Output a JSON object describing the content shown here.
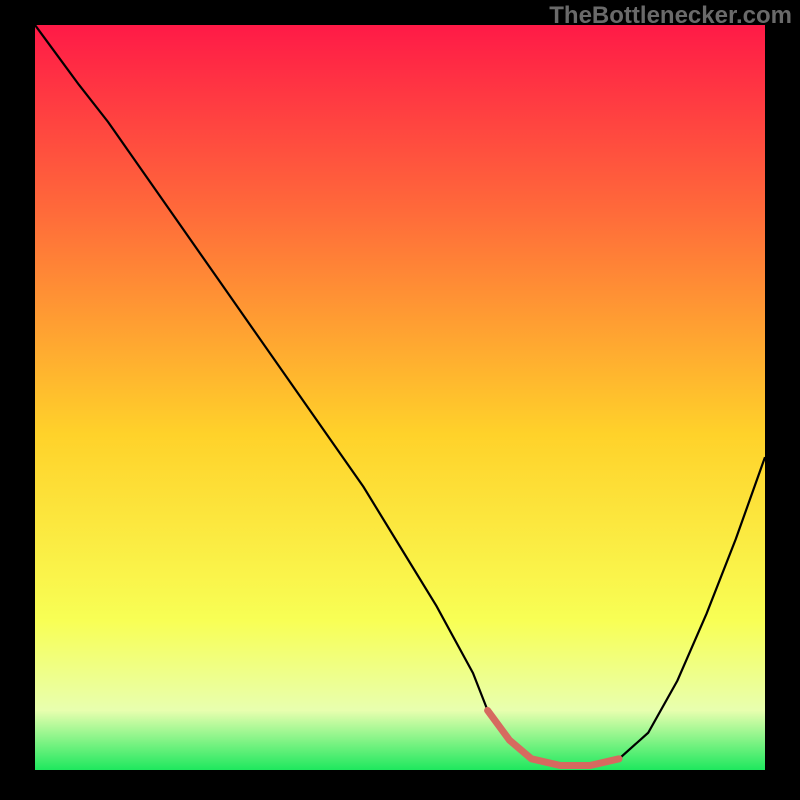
{
  "watermark": "TheBottlenecker.com",
  "chart_data": {
    "type": "line",
    "title": "",
    "xlabel": "",
    "ylabel": "",
    "xlim": [
      0,
      100
    ],
    "ylim": [
      0,
      100
    ],
    "grid": false,
    "background_gradient": {
      "stops": [
        {
          "offset": 0,
          "color": "#ff1a47"
        },
        {
          "offset": 25,
          "color": "#ff6a3a"
        },
        {
          "offset": 55,
          "color": "#ffd22a"
        },
        {
          "offset": 80,
          "color": "#f8ff55"
        },
        {
          "offset": 92,
          "color": "#e8ffaf"
        },
        {
          "offset": 100,
          "color": "#1ee85e"
        }
      ]
    },
    "series": [
      {
        "name": "curve",
        "color": "#000000",
        "x": [
          0,
          3,
          6,
          10,
          15,
          20,
          25,
          30,
          35,
          40,
          45,
          50,
          55,
          60,
          62,
          65,
          68,
          72,
          76,
          80,
          84,
          88,
          92,
          96,
          100
        ],
        "y": [
          100,
          96,
          92,
          87,
          80,
          73,
          66,
          59,
          52,
          45,
          38,
          30,
          22,
          13,
          8,
          4,
          1.5,
          0.6,
          0.6,
          1.5,
          5,
          12,
          21,
          31,
          42
        ]
      }
    ],
    "highlight": {
      "name": "optimal-range",
      "color": "#d66a5f",
      "stroke_width": 7,
      "x": [
        62,
        65,
        68,
        72,
        76,
        80
      ],
      "y": [
        8,
        4,
        1.5,
        0.6,
        0.6,
        1.5
      ]
    }
  }
}
